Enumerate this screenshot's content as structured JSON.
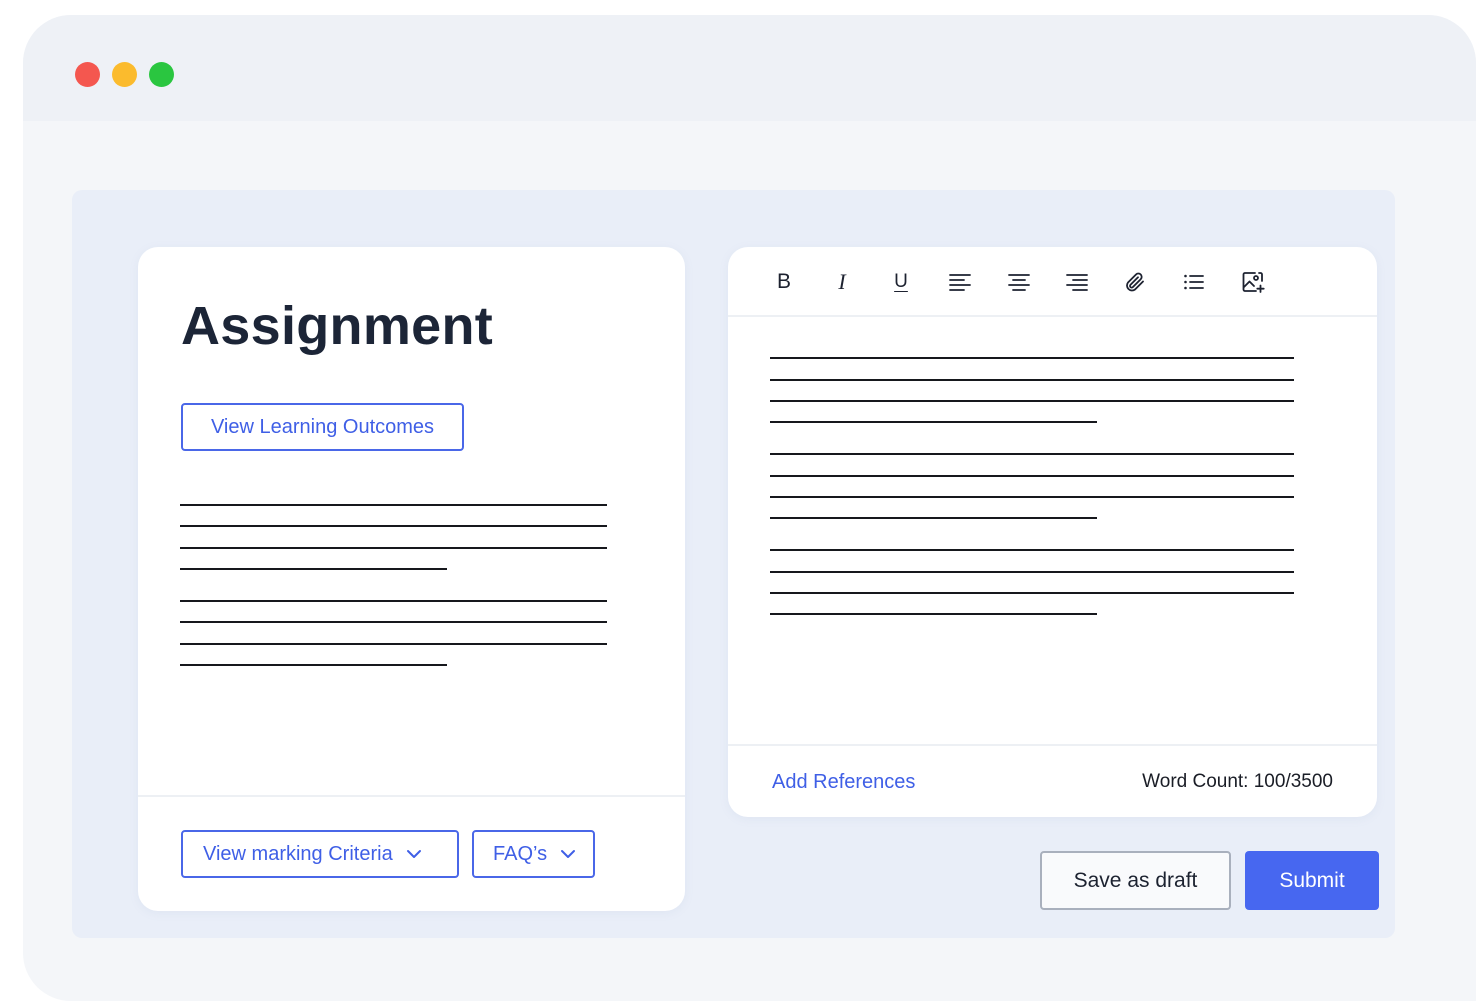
{
  "window": {
    "controls": [
      "close",
      "minimize",
      "maximize"
    ]
  },
  "assignment": {
    "title": "Assignment",
    "outcomes_button": "View Learning Outcomes",
    "criteria_button": "View marking Criteria",
    "faq_button": "FAQ’s"
  },
  "editor": {
    "tools": [
      "bold-icon",
      "italic-icon",
      "underline-icon",
      "align-left-icon",
      "align-center-icon",
      "align-right-icon",
      "attachment-icon",
      "list-icon",
      "insert-image-icon"
    ],
    "bold_label": "B",
    "italic_label": "I",
    "underline_label": "U",
    "add_references": "Add References",
    "word_count": "Word Count: 100/3500"
  },
  "actions": {
    "save_draft": "Save as draft",
    "submit": "Submit"
  },
  "colors": {
    "accent": "#4767f0",
    "link": "#3f5fe6",
    "close": "#f4574f",
    "minimize": "#fbbb2d",
    "maximize": "#2ac640"
  }
}
